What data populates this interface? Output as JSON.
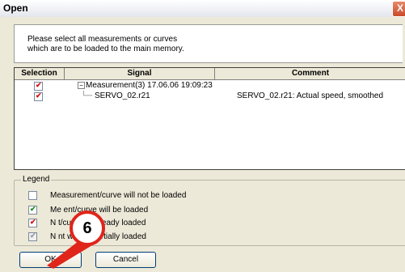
{
  "window": {
    "title": "Open",
    "close_icon": "close-icon",
    "close_glyph": "X"
  },
  "header": {
    "instruction": "Please select all measurements or curves\nwhich are to be loaded to the main memory."
  },
  "table": {
    "columns": [
      "Selection",
      "Signal",
      "Comment"
    ],
    "rows": [
      {
        "checked": true,
        "expander": "−",
        "signal": "Measurement(3)  17.06.06 19:09:23",
        "comment": ""
      },
      {
        "checked": true,
        "expander": "",
        "signal": "SERVO_02.r21",
        "comment": "SERVO_02.r21: Actual speed, smoothed"
      }
    ]
  },
  "legend": {
    "title": "Legend",
    "items": [
      {
        "state": "unchecked",
        "label": "Measurement/curve will not be loaded"
      },
      {
        "state": "green",
        "label": "Me                ent/curve will be loaded"
      },
      {
        "state": "red",
        "label": "N              t/curve is already loaded"
      },
      {
        "state": "gray",
        "label": "N              nt will be partially loaded"
      }
    ]
  },
  "buttons": {
    "ok": "OK",
    "cancel": "Cancel"
  },
  "callout": {
    "number": "6",
    "color": "#e0251b"
  },
  "colors": {
    "dialog_bg": "#ece9d8",
    "check_red": "#d01010",
    "check_green": "#1e8a1e"
  }
}
